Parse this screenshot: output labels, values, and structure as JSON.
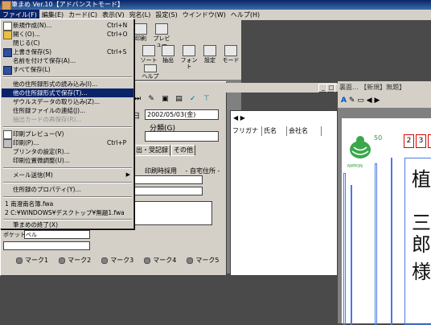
{
  "window": {
    "title": "筆まめ Ver.10【アドバンストモード】"
  },
  "menubar": [
    {
      "label": "ファイル(F)",
      "active": true
    },
    {
      "label": "編集(E)"
    },
    {
      "label": "カード(C)"
    },
    {
      "label": "表示(V)"
    },
    {
      "label": "宛名(L)"
    },
    {
      "label": "設定(S)"
    },
    {
      "label": "ウインドウ(W)"
    },
    {
      "label": "ヘルプ(H)"
    }
  ],
  "toolbar": {
    "print": "印刷",
    "preview": "プレビュー",
    "sort": "ソート",
    "extract": "抽出",
    "font": "フォント",
    "settings": "設定",
    "mode": "モード",
    "help": "ヘルプ"
  },
  "file_menu": {
    "items": [
      {
        "label": "新規作成(N)...",
        "shortcut": "Ctrl+N",
        "icon": "new-file-icon"
      },
      {
        "label": "開く(O)...",
        "shortcut": "Ctrl+O",
        "icon": "open-folder-icon"
      },
      {
        "label": "閉じる(C)"
      },
      {
        "label": "上書き保存(S)",
        "shortcut": "Ctrl+S",
        "icon": "save-icon"
      },
      {
        "label": "名前を付けて保存(A)..."
      },
      {
        "label": "すべて保存(L)",
        "icon": "save-all-icon"
      },
      {
        "label": "他の住所録形式の読み込み(I)..."
      },
      {
        "label": "他の住所録形式で保存(T)...",
        "highlighted": true
      },
      {
        "label": "ザウルスデータの取り込み(Z)..."
      },
      {
        "label": "住所録ファイルの連結(J)..."
      },
      {
        "label": "抽出カードの再保存(R)...",
        "disabled": true
      },
      {
        "label": "印刷プレビュー(V)",
        "icon": "print-preview-icon"
      },
      {
        "label": "印刷(P)...",
        "shortcut": "Ctrl+P",
        "icon": "printer-icon"
      },
      {
        "label": "プリンタの設定(R)..."
      },
      {
        "label": "印刷位置微調整(U)..."
      },
      {
        "label": "メール送信(M)",
        "submenu": true
      },
      {
        "label": "住所録のプロパティ(Y)..."
      },
      {
        "label": "1 南澄南名簿.fwa"
      },
      {
        "label": "2 C:¥WINDOWS¥デスクトップ¥無題1.fwa"
      },
      {
        "label": "筆まめの終了(X)"
      }
    ]
  },
  "address_form": {
    "date_label": "日",
    "date_value": "2002/05/03(金)",
    "category_label": "分類(G)",
    "tabs": [
      "出・受記録",
      "その他"
    ],
    "print_label": "印刷時採用",
    "home_label": "- 自宅住所 -",
    "pocketbell_label": "ポケットベル",
    "marks": [
      "マーク1",
      "マーク2",
      "マーク3",
      "マーク4",
      "マーク5"
    ]
  },
  "list": {
    "columns": [
      "フリガナ",
      "氏名",
      "会社名"
    ]
  },
  "preview": {
    "title": "裏面... 【新規】無題】",
    "postal_digits": [
      "2",
      "3"
    ],
    "stamp_value": "50",
    "stamp_text": "NIPPON",
    "vertical_name": [
      "植",
      "三",
      "郎",
      "様"
    ]
  }
}
